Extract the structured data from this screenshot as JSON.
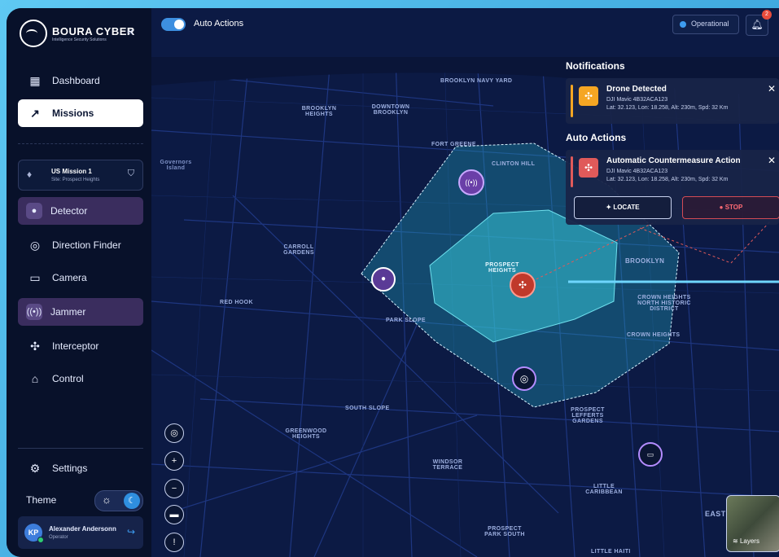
{
  "brand": {
    "name": "BOURA CYBER",
    "tagline": "Intelligence Security Solutions"
  },
  "sidebar": {
    "items": [
      {
        "label": "Dashboard",
        "icon": "grid-icon"
      },
      {
        "label": "Missions",
        "icon": "route-icon"
      },
      {
        "label": "Detector",
        "icon": "detector-icon"
      },
      {
        "label": "Direction Finder",
        "icon": "direction-icon"
      },
      {
        "label": "Camera",
        "icon": "camera-icon"
      },
      {
        "label": "Jammer",
        "icon": "jammer-icon"
      },
      {
        "label": "Interceptor",
        "icon": "drone-icon"
      },
      {
        "label": "Control",
        "icon": "gamepad-icon"
      }
    ],
    "mission": {
      "title": "US Mission 1",
      "site": "Site: Prospect Heights"
    },
    "settings_label": "Settings",
    "theme_label": "Theme",
    "user": {
      "initials": "KP",
      "name": "Alexander Andersonn",
      "role": "Operator"
    }
  },
  "topbar": {
    "auto_actions_label": "Auto Actions",
    "status": "Operational",
    "notification_count": "2"
  },
  "notifications": {
    "title": "Notifications",
    "items": [
      {
        "title": "Drone Detected",
        "model": "DJI Mavic 4B32ACA123",
        "details": "Lat: 32.123, Lon: 18.258, Alt: 230m, Spd: 32 Km"
      }
    ]
  },
  "auto_actions": {
    "title": "Auto Actions",
    "items": [
      {
        "title": "Automatic Countermeasure Action",
        "model": "DJI Mavic 4B32ACA123",
        "details": "Lat: 32.123, Lon: 18.258, Alt: 230m, Spd: 32 Km"
      }
    ],
    "locate_label": "LOCATE",
    "stop_label": "STOP"
  },
  "map": {
    "layers_label": "Layers",
    "labels": [
      "BROOKLYN NAVY YARD",
      "BROOKLYN HEIGHTS",
      "DOWNTOWN BROOKLYN",
      "FORT GREENE",
      "CLINTON HILL",
      "Governors Island",
      "CARROLL GARDENS",
      "PROSPECT HEIGHTS",
      "RED HOOK",
      "PARK SLOPE",
      "BROOKLYN",
      "CROWN HEIGHTS NORTH HISTORIC DISTRICT",
      "CROWN HEIGHTS",
      "SOUTH SLOPE",
      "GREENWOOD HEIGHTS",
      "WINDSOR TERRACE",
      "PROSPECT LEFFERTS GARDENS",
      "LITTLE CARIBBEAN",
      "PROSPECT PARK SOUTH",
      "LITTLE HAITI",
      "EAST F"
    ]
  },
  "colors": {
    "accent": "#3d8fe0",
    "zone_outer": "#2bb6c9",
    "zone_inner": "#36c4d6",
    "threat": "#c0392b",
    "jammer": "#7b4fb8"
  }
}
